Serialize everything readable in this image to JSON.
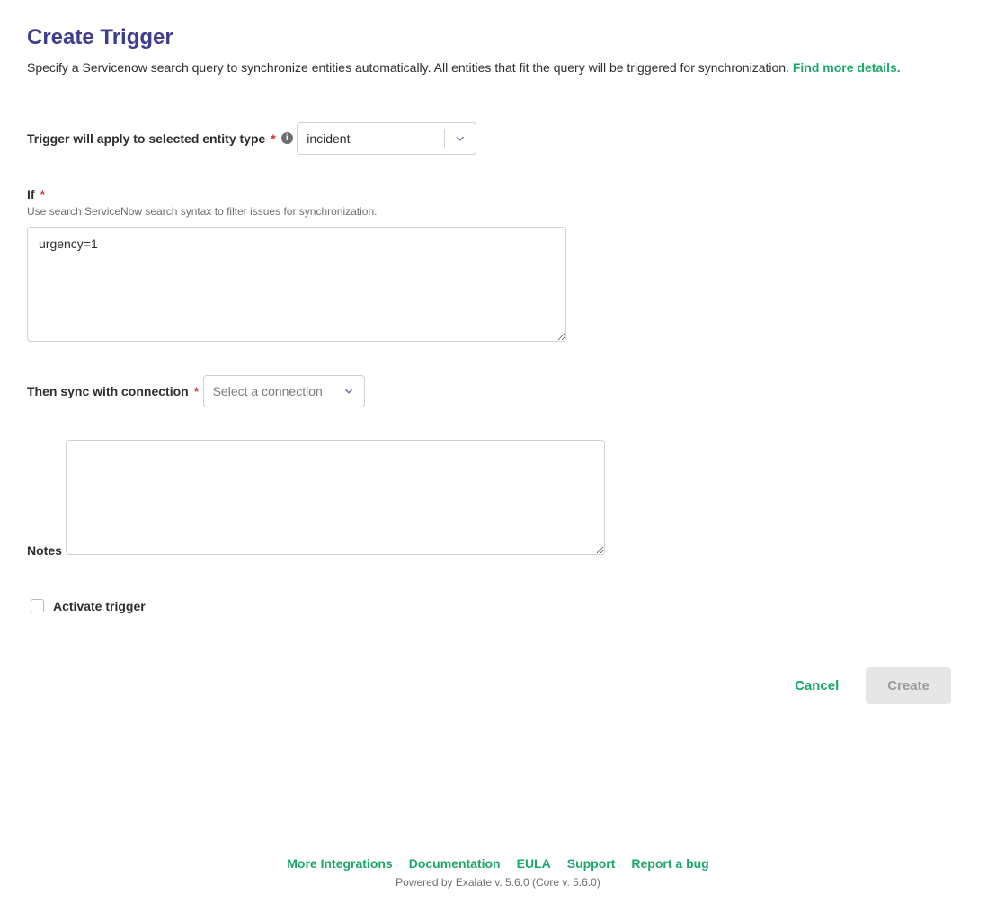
{
  "header": {
    "title": "Create Trigger",
    "description_prefix": "Specify a Servicenow search query to synchronize entities automatically. All entities that fit the query will be triggered for synchronization. ",
    "details_link": "Find more details."
  },
  "entity_type": {
    "label": "Trigger will apply to selected entity type",
    "value": "incident"
  },
  "if_block": {
    "label": "If",
    "help": "Use search ServiceNow search syntax to filter issues for synchronization.",
    "value": "urgency=1"
  },
  "connection": {
    "label": "Then sync with connection",
    "placeholder": "Select a connection"
  },
  "notes": {
    "label": "Notes",
    "value": ""
  },
  "activate": {
    "label": "Activate trigger",
    "checked": false
  },
  "buttons": {
    "cancel": "Cancel",
    "create": "Create"
  },
  "footer": {
    "links": {
      "more_integrations": "More Integrations",
      "documentation": "Documentation",
      "eula": "EULA",
      "support": "Support",
      "report_bug": "Report a bug"
    },
    "version": "Powered by Exalate v. 5.6.0 (Core v. 5.6.0)"
  }
}
